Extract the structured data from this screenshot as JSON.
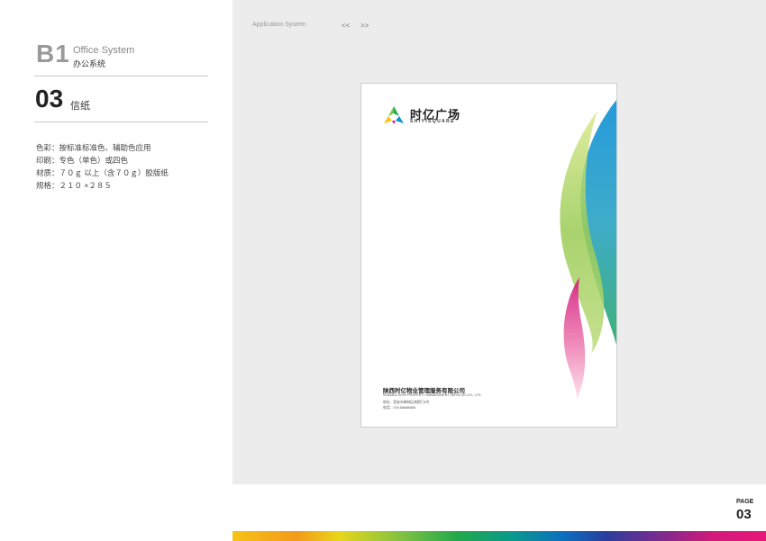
{
  "section": {
    "code": "B1",
    "name_en": "Office System",
    "name_cn": "办公系统"
  },
  "item": {
    "number": "03",
    "name": "信纸"
  },
  "specs": [
    "色彩：按标准标准色、辅助色应用",
    "印刷：专色（单色）或四色",
    "材质：７０ｇ 以上（含７０ｇ）胶版纸",
    "规格：２１０ ×２８５"
  ],
  "header": {
    "app_system": "Application System",
    "prev": "<<",
    "next": ">>"
  },
  "letterhead": {
    "logo_cn": "时亿广场",
    "logo_en": "SHIYISQUARE",
    "company_cn": "陕西时亿物业管理服务有限公司",
    "company_en": "SHAANXI SHIYI PROPERTY MANAGEMENT SERVICES CO., LTD.",
    "address": "地址：西安市碑林区南稍门5号",
    "phone": "电话：029-88888888"
  },
  "page": {
    "label": "PAGE",
    "number": "03"
  },
  "colors": {
    "accent_green": "#7dc143",
    "accent_blue": "#0c8fd6",
    "accent_pink": "#e8177a",
    "accent_yellow": "#f6c316"
  }
}
